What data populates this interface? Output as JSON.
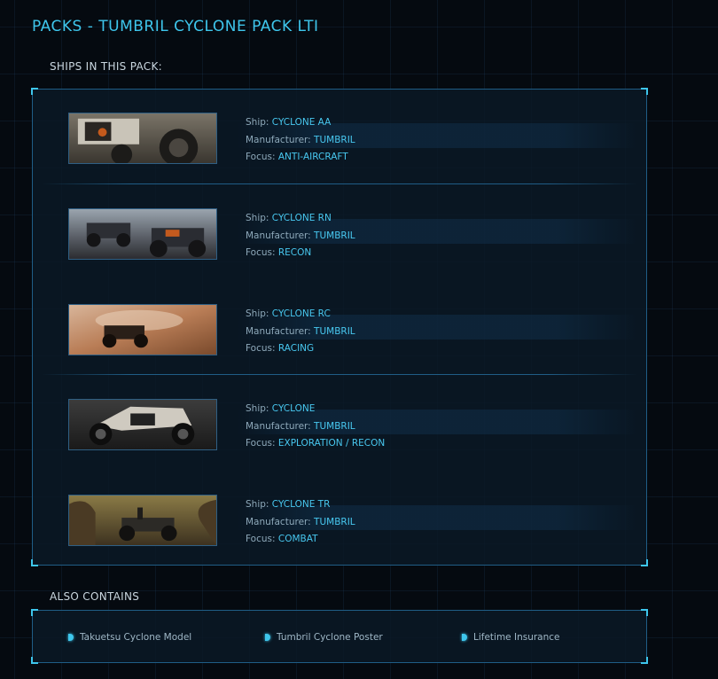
{
  "page": {
    "title": "PACKS - TUMBRIL CYCLONE PACK LTI"
  },
  "ships_section": {
    "label": "SHIPS IN THIS PACK:"
  },
  "labels": {
    "ship": "Ship:",
    "manufacturer": "Manufacturer:",
    "focus": "Focus:"
  },
  "ships": [
    {
      "name": "CYCLONE AA",
      "manufacturer": "TUMBRIL",
      "focus": "ANTI-AIRCRAFT",
      "image": "cyclone-aa-image"
    },
    {
      "name": "CYCLONE RN",
      "manufacturer": "TUMBRIL",
      "focus": "RECON",
      "image": "cyclone-rn-image"
    },
    {
      "name": "CYCLONE RC",
      "manufacturer": "TUMBRIL",
      "focus": "RACING",
      "image": "cyclone-rc-image"
    },
    {
      "name": "CYCLONE",
      "manufacturer": "TUMBRIL",
      "focus": "EXPLORATION / RECON",
      "image": "cyclone-image"
    },
    {
      "name": "CYCLONE TR",
      "manufacturer": "TUMBRIL",
      "focus": "COMBAT",
      "image": "cyclone-tr-image"
    }
  ],
  "also_contains": {
    "label": "ALSO CONTAINS",
    "items": [
      "Takuetsu Cyclone Model",
      "Tumbril Cyclone Poster",
      "Lifetime Insurance"
    ]
  },
  "colors": {
    "accent": "#3ec6ec",
    "value_text": "#48c8f0",
    "border": "#1f5d86",
    "background": "#050a10"
  }
}
